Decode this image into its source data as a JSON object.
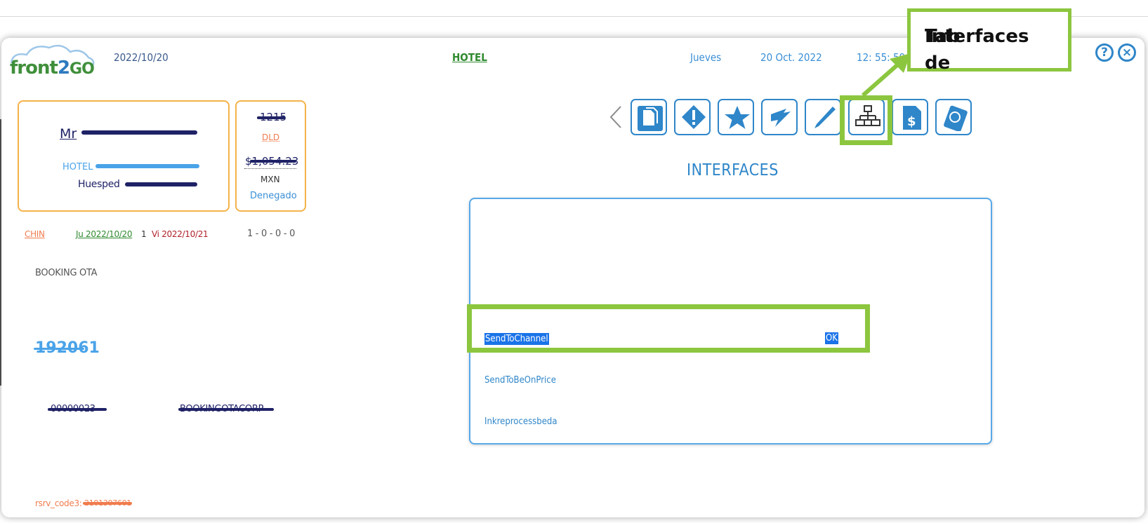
{
  "header": {
    "logo_text_front": "front",
    "logo_text_two": "2",
    "logo_text_go": "GO",
    "date": "2022/10/20",
    "hotel_link": "HOTEL",
    "weekday": "Jueves",
    "full_date": "20 Oct. 2022",
    "time": "12: 55: 59",
    "help_icon": "?",
    "close_icon": "×"
  },
  "guest_card": {
    "title_prefix": "Mr",
    "hotel_label": "HOTEL",
    "guest_label": "Huesped"
  },
  "side_card": {
    "room": "1215",
    "room_type": "DLD",
    "amount": "$1,054.23",
    "currency": "MXN",
    "status": "Denegado"
  },
  "stay": {
    "status": "CHIN",
    "arrival": "Ju 2022/10/20",
    "nights": "1",
    "departure": "Vi 2022/10/21",
    "occupancy": "1 - 0 - 0 - 0"
  },
  "source": "BOOKING OTA",
  "reservation_number": "192061",
  "left_bottom": {
    "company_code": "00000023",
    "company_name": "BOOKINGOTACORP",
    "rsrv_label": "rsrv_code3:",
    "rsrv_value": "2101307601"
  },
  "tabs": [
    {
      "name": "documents-icon"
    },
    {
      "name": "alert-icon"
    },
    {
      "name": "star-icon"
    },
    {
      "name": "flag-icon"
    },
    {
      "name": "pen-icon"
    },
    {
      "name": "interfaces-icon"
    },
    {
      "name": "billing-icon"
    },
    {
      "name": "passport-icon"
    }
  ],
  "callout": {
    "line1": "Tab de",
    "line2": "Interfaces"
  },
  "interfaces": {
    "title": "INTERFACES",
    "rows": [
      {
        "name": "SendToChannel",
        "status": "OK"
      },
      {
        "name": "SendToBeOnPrice",
        "status": ""
      },
      {
        "name": "Inkreprocessbeda",
        "status": ""
      }
    ]
  },
  "colors": {
    "accent": "#2f86c9",
    "highlight": "#8cc63f",
    "card_border": "#f4b24a",
    "selection": "#1a73e8"
  }
}
